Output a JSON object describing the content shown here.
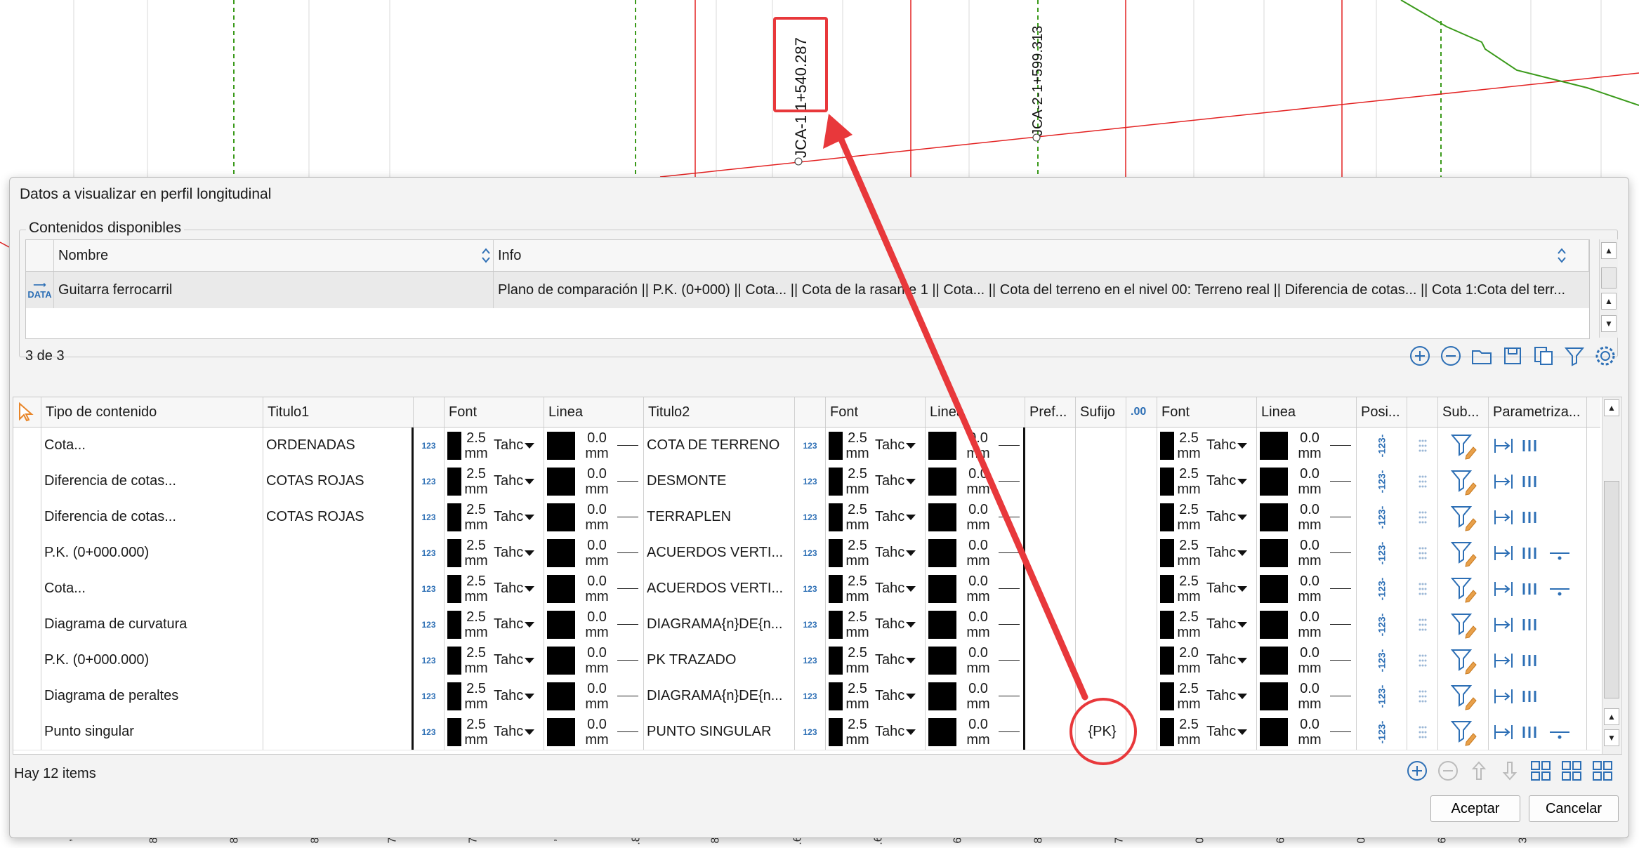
{
  "background": {
    "station_labels": [
      "JCA-1 1+540.287",
      "JCA-2-1+599.313"
    ],
    "bottom_ticks": [
      ",",
      "8",
      "8",
      "8",
      "7",
      "7",
      ",",
      ".8",
      "8",
      ".6",
      ".6",
      "6",
      "8",
      "7",
      "0",
      "6",
      "0",
      "6",
      "3"
    ]
  },
  "dialog": {
    "title": "Datos a visualizar en perfil longitudinal",
    "group_title": "Contenidos disponibles",
    "top_table": {
      "columns": [
        "Nombre",
        "Info"
      ],
      "row": {
        "icon_text": "DATA",
        "nombre": "Guitarra ferrocarril",
        "info": "Plano de comparación || P.K. (0+000) || Cota... || Cota de la rasante 1 || Cota... || Cota del terreno en el nivel 00: Terreno real || Diferencia de cotas... || Cota 1:Cota del terr..."
      }
    },
    "count_top": "3 de 3",
    "main_grid": {
      "columns": [
        "Tipo de contenido",
        "Titulo1",
        "Font",
        "Linea",
        "Titulo2",
        "Font",
        "Linea",
        "Pref...",
        "Sufijo",
        ".00",
        "Font",
        "Linea",
        "Posi...",
        "Sub...",
        "Parametriza..."
      ],
      "rows": [
        {
          "tipo": "Cota...",
          "titulo1": "ORDENADAS",
          "titulo2": "COTA DE TERRENO",
          "f1": "2.5",
          "f2": "2.5",
          "f3": "2.5",
          "sufijo": "",
          "marker": false
        },
        {
          "tipo": "Diferencia de cotas...",
          "titulo1": "COTAS ROJAS",
          "titulo2": "DESMONTE",
          "f1": "2.5",
          "f2": "2.5",
          "f3": "2.5",
          "sufijo": "",
          "marker": false
        },
        {
          "tipo": "Diferencia de cotas...",
          "titulo1": "COTAS ROJAS",
          "titulo2": "TERRAPLEN",
          "f1": "2.5",
          "f2": "2.5",
          "f3": "2.5",
          "sufijo": "",
          "marker": false
        },
        {
          "tipo": "P.K. (0+000.000)",
          "titulo1": "",
          "titulo2": "ACUERDOS VERTI...",
          "f1": "2.5",
          "f2": "2.5",
          "f3": "2.5",
          "sufijo": "",
          "marker": true
        },
        {
          "tipo": "Cota...",
          "titulo1": "",
          "titulo2": "ACUERDOS VERTI...",
          "f1": "2.5",
          "f2": "2.5",
          "f3": "2.5",
          "sufijo": "",
          "marker": true
        },
        {
          "tipo": "Diagrama de curvatura",
          "titulo1": "",
          "titulo2": "DIAGRAMA{n}DE{n...",
          "f1": "2.5",
          "f2": "2.5",
          "f3": "2.5",
          "sufijo": "",
          "marker": false
        },
        {
          "tipo": "P.K. (0+000.000)",
          "titulo1": "",
          "titulo2": "PK TRAZADO",
          "f1": "2.5",
          "f2": "2.5",
          "f3": "2.0",
          "sufijo": "",
          "marker": false
        },
        {
          "tipo": "Diagrama de peraltes",
          "titulo1": "",
          "titulo2": "DIAGRAMA{n}DE{n...",
          "f1": "2.5",
          "f2": "2.5",
          "f3": "2.5",
          "sufijo": "",
          "marker": false
        },
        {
          "tipo": "Punto singular",
          "titulo1": "",
          "titulo2": "PUNTO SINGULAR",
          "f1": "2.5",
          "f2": "2.5",
          "f3": "2.5",
          "sufijo": "{PK}",
          "marker": true
        }
      ],
      "font_unit": "mm",
      "font_name": "Tahc",
      "line_value": "0.0",
      "num_icon": "123",
      "pos_icon": "-123-"
    },
    "footer_count": "Hay 12 items",
    "buttons": {
      "accept": "Aceptar",
      "cancel": "Cancelar"
    }
  },
  "colors": {
    "annotation": "#e8383b",
    "accent": "#2d6fb5",
    "cad_red": "#e32222",
    "cad_green": "#3a9a1a"
  }
}
